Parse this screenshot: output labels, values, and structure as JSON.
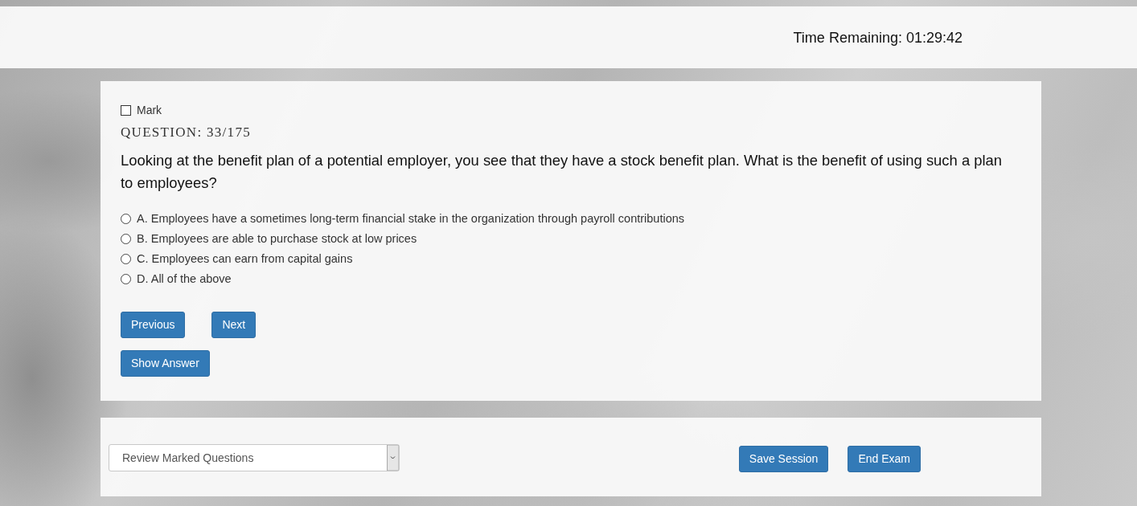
{
  "header": {
    "time_remaining": "Time Remaining: 01:29:42"
  },
  "question": {
    "mark": {
      "label": "Mark",
      "checked": false
    },
    "number": "QUESTION: 33/175",
    "text": "Looking at the benefit plan of a potential employer, you see that they have a stock benefit plan. What is the benefit of using such a plan to employees?",
    "options": [
      {
        "label": "A. Employees have a sometimes long-term financial stake in the organization through payroll contributions",
        "selected": false
      },
      {
        "label": "B. Employees are able to purchase stock at low prices",
        "selected": false
      },
      {
        "label": "C. Employees can earn from capital gains",
        "selected": false
      },
      {
        "label": "D. All of the above",
        "selected": false
      }
    ],
    "navigation_buttons": [
      "Previous",
      "Next"
    ],
    "answer_button": "Show Answer"
  },
  "footer": {
    "review_select": {
      "value": "Review Marked Questions"
    },
    "buttons": [
      "Save Session",
      "End Exam"
    ]
  }
}
